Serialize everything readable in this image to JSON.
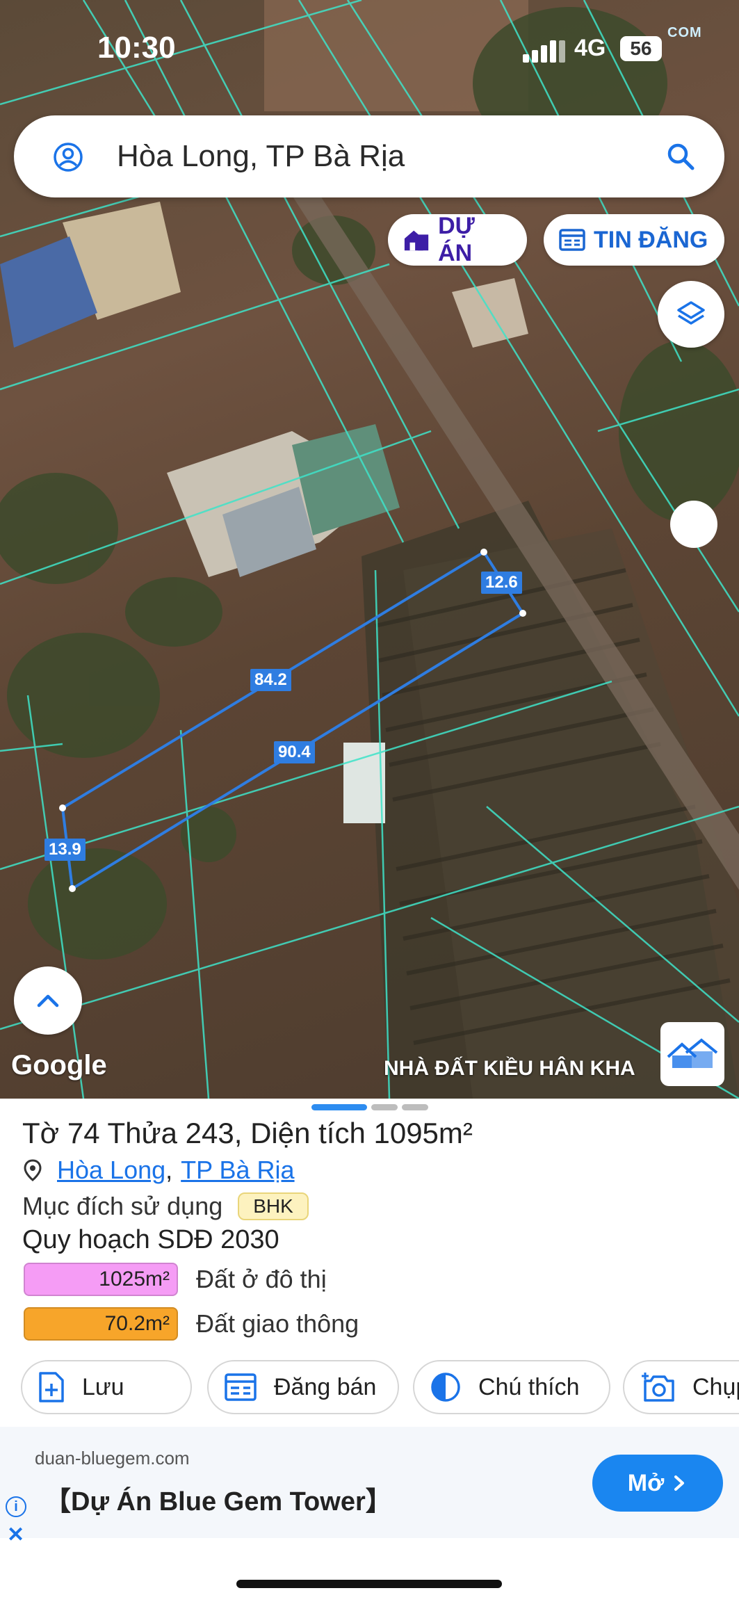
{
  "status_bar": {
    "time": "10:30",
    "network": "4G",
    "battery": "56"
  },
  "watermark_top": "COM",
  "search": {
    "text": "Hòa Long, TP Bà Rịa"
  },
  "chips": {
    "du_an": "DỰ ÁN",
    "tin_dang": "TIN ĐĂNG"
  },
  "map": {
    "google_label": "Google",
    "watermark_text": "NHÀ ĐẤT KIỀU HÂN KHA",
    "watermark_logo_text": "KIỀU HÂN KHANG",
    "dimensions": [
      "12.6",
      "84.2",
      "90.4",
      "13.9"
    ]
  },
  "parcel": {
    "title": "Tờ 74 Thửa 243, Diện tích 1095m²",
    "ward": "Hòa Long",
    "city": "TP Bà Rịa",
    "purpose_label": "Mục đích sử dụng",
    "purpose_code": "BHK",
    "plan_title": "Quy hoạch SDĐ 2030",
    "plans": [
      {
        "area": "1025m²",
        "label": "Đất ở đô thị",
        "color": "#f59cf5"
      },
      {
        "area": "70.2m²",
        "label": "Đất giao thông",
        "color": "#f7a52a"
      }
    ]
  },
  "actions": {
    "save": "Lưu",
    "post": "Đăng bán",
    "legend": "Chú thích",
    "capture": "Chụp"
  },
  "ad": {
    "domain": "duan-bluegem.com",
    "title": "【Dự Án Blue Gem Tower】",
    "button": "Mở"
  }
}
